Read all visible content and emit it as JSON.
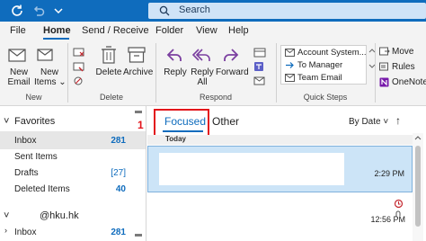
{
  "titlebar": {
    "search_placeholder": "Search",
    "icons": [
      "sync-icon",
      "undo-icon",
      "customize-qat-icon",
      "search-icon"
    ]
  },
  "menu": {
    "tabs": [
      "File",
      "Home",
      "Send / Receive",
      "Folder",
      "View",
      "Help"
    ],
    "active": "Home"
  },
  "ribbon": {
    "new_email": "New\nEmail",
    "new_items": "New\nItems",
    "delete": "Delete",
    "archive": "Archive",
    "reply": "Reply",
    "reply_all": "Reply\nAll",
    "forward": "Forward",
    "quick_steps": [
      "Account System...",
      "To Manager",
      "Team Email"
    ],
    "move": "Move",
    "rules": "Rules",
    "onenote": "OneNote",
    "groups": {
      "new": "New",
      "delete": "Delete",
      "respond": "Respond",
      "quick_steps": "Quick Steps"
    }
  },
  "folders": {
    "favorites_label": "Favorites",
    "items": [
      {
        "name": "Inbox",
        "count": "281"
      },
      {
        "name": "Sent Items",
        "count": ""
      },
      {
        "name": "Drafts",
        "count": "[27]"
      },
      {
        "name": "Deleted Items",
        "count": "40"
      }
    ],
    "account_label": "@hku.hk",
    "account_items": [
      {
        "name": "Inbox",
        "count": "281"
      }
    ]
  },
  "maillist": {
    "tabs": [
      "Focused",
      "Other"
    ],
    "active_tab": "Focused",
    "sort_label": "By Date",
    "group_label": "Today",
    "annotation": "1",
    "messages": [
      {
        "time": "2:29 PM",
        "selected": true
      },
      {
        "time": "12:56 PM",
        "selected": false
      }
    ]
  },
  "colors": {
    "accent": "#0f6cbd",
    "annotation": "#e3141b",
    "selected_mail": "#cce4f7"
  }
}
